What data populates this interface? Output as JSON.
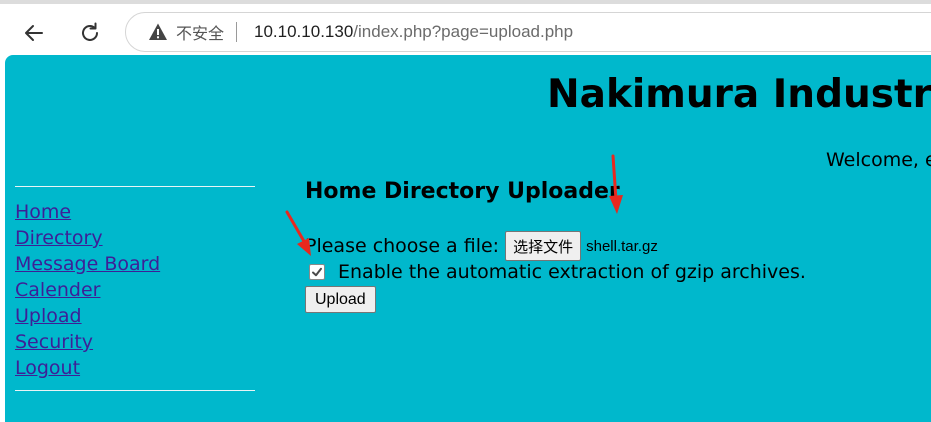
{
  "browser": {
    "security_label": "不安全",
    "url_host": "10.10.10.130",
    "url_path": "/index.php?page=upload.php",
    "icons": {
      "back": "arrow-left",
      "reload": "refresh",
      "security": "warning-triangle"
    }
  },
  "page": {
    "site_title": "Nakimura Industrie",
    "welcome_text": "Welcome, e",
    "nav": [
      {
        "label": "Home"
      },
      {
        "label": "Directory"
      },
      {
        "label": "Message Board"
      },
      {
        "label": "Calender"
      },
      {
        "label": "Upload"
      },
      {
        "label": "Security"
      },
      {
        "label": "Logout"
      }
    ],
    "uploader": {
      "heading": "Home Directory Uploader",
      "choose_label": "Please choose a file:",
      "choose_button": "选择文件",
      "selected_file": "shell.tar.gz",
      "extract_checked": true,
      "extract_label": "Enable the automatic extraction of gzip archives.",
      "upload_button": "Upload"
    }
  },
  "colors": {
    "page_background": "#00b8cc",
    "link": "#3d1f97",
    "annotation_arrow": "#e8281e"
  }
}
